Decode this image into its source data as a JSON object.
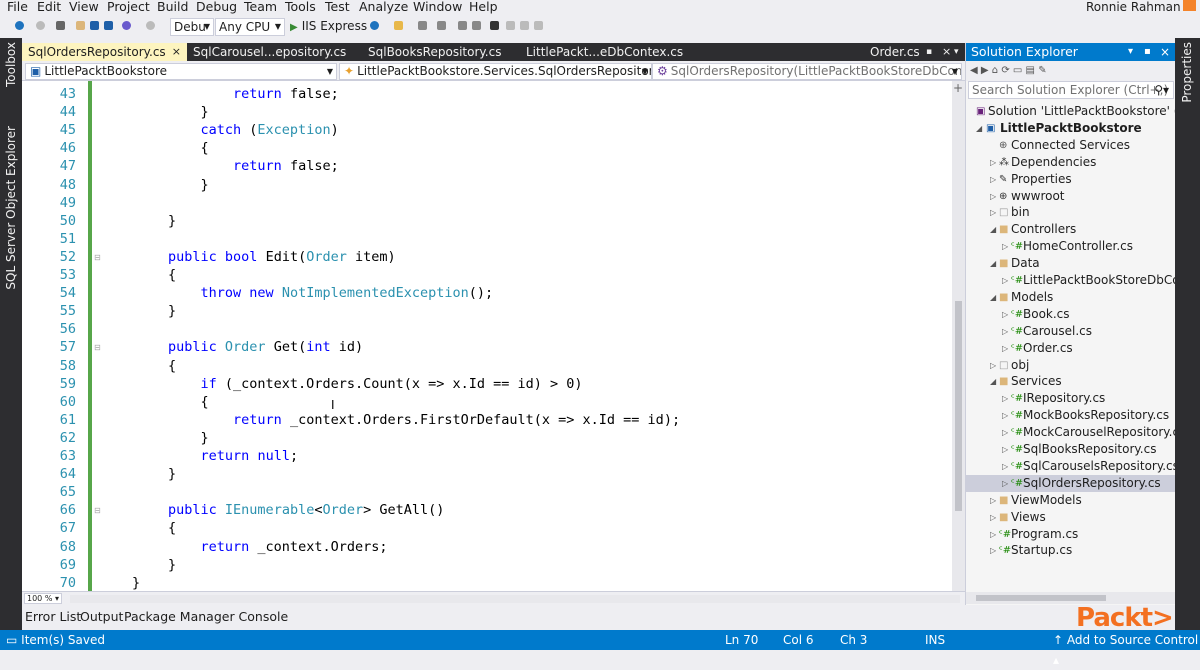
{
  "menu": [
    "File",
    "Edit",
    "View",
    "Project",
    "Build",
    "Debug",
    "Team",
    "Tools",
    "Test",
    "Analyze",
    "Window",
    "Help"
  ],
  "user": "Ronnie Rahman",
  "toolbar": {
    "config": "Debu",
    "platform": "Any CPU",
    "run": "IIS Express"
  },
  "tabs": [
    {
      "label": "SqlOrdersRepository.cs",
      "close": "×",
      "active": true
    },
    {
      "label": "SqlCarousel...epository.cs"
    },
    {
      "label": "SqlBooksRepository.cs"
    },
    {
      "label": "LittlePackt...eDbContex.cs"
    },
    {
      "label": "Order.cs"
    }
  ],
  "nav": {
    "project": "LittlePacktBookstore",
    "class": "LittlePacktBookstore.Services.SqlOrdersRepository",
    "member": "SqlOrdersRepository(LittlePacktBookStoreDbContex cor"
  },
  "left_rail": [
    "Toolbox",
    "SQL Server Object Explorer"
  ],
  "right_rail": "Properties",
  "code": {
    "line_numbers": [
      "43",
      "44",
      "45",
      "46",
      "47",
      "48",
      "49",
      "50",
      "51",
      "52",
      "53",
      "54",
      "55",
      "56",
      "57",
      "58",
      "59",
      "60",
      "61",
      "62",
      "63",
      "64",
      "65",
      "66",
      "67",
      "68",
      "69",
      "70"
    ],
    "lines": [
      [
        [
          "        ",
          ""
        ],
        [
          "return",
          "kw"
        ],
        [
          " false;",
          ""
        ]
      ],
      [
        [
          "    }",
          ""
        ]
      ],
      [
        [
          "    ",
          ""
        ],
        [
          "catch",
          "kw"
        ],
        [
          " (",
          ""
        ],
        [
          "Exception",
          "ty"
        ],
        [
          ")",
          ""
        ]
      ],
      [
        [
          "    {",
          ""
        ]
      ],
      [
        [
          "        ",
          ""
        ],
        [
          "return",
          "kw"
        ],
        [
          " false;",
          ""
        ]
      ],
      [
        [
          "    }",
          ""
        ]
      ],
      [
        [
          "",
          ""
        ]
      ],
      [
        [
          "}",
          ""
        ]
      ],
      [
        [
          "",
          ""
        ]
      ],
      [
        [
          "",
          ""
        ],
        [
          "public",
          "kw"
        ],
        [
          " ",
          ""
        ],
        [
          "bool",
          "kw"
        ],
        [
          " Edit(",
          ""
        ],
        [
          "Order",
          "ty"
        ],
        [
          " item)",
          ""
        ]
      ],
      [
        [
          "{",
          ""
        ]
      ],
      [
        [
          "    ",
          ""
        ],
        [
          "throw",
          "kw"
        ],
        [
          " ",
          ""
        ],
        [
          "new",
          "kw"
        ],
        [
          " ",
          ""
        ],
        [
          "NotImplementedException",
          "ty"
        ],
        [
          "();",
          ""
        ]
      ],
      [
        [
          "}",
          ""
        ]
      ],
      [
        [
          "",
          ""
        ]
      ],
      [
        [
          "",
          ""
        ],
        [
          "public",
          "kw"
        ],
        [
          " ",
          ""
        ],
        [
          "Order",
          "ty"
        ],
        [
          " Get(",
          ""
        ],
        [
          "int",
          "kw"
        ],
        [
          " id)",
          ""
        ]
      ],
      [
        [
          "{",
          ""
        ]
      ],
      [
        [
          "    ",
          ""
        ],
        [
          "if",
          "kw"
        ],
        [
          " (_context.Orders.Count(x => x.Id == id) > 0)",
          ""
        ]
      ],
      [
        [
          "    {",
          ""
        ]
      ],
      [
        [
          "        ",
          ""
        ],
        [
          "return",
          "kw"
        ],
        [
          " _context.Orders.FirstOrDefault(x => x.Id == id);",
          ""
        ]
      ],
      [
        [
          "    }",
          ""
        ]
      ],
      [
        [
          "    ",
          ""
        ],
        [
          "return",
          "kw"
        ],
        [
          " ",
          ""
        ],
        [
          "null",
          "kw"
        ],
        [
          ";",
          ""
        ]
      ],
      [
        [
          "}",
          ""
        ]
      ],
      [
        [
          "",
          ""
        ]
      ],
      [
        [
          "",
          ""
        ],
        [
          "public",
          "kw"
        ],
        [
          " ",
          ""
        ],
        [
          "IEnumerable",
          "ty"
        ],
        [
          "<",
          ""
        ],
        [
          "Order",
          "ty"
        ],
        [
          "> GetAll()",
          ""
        ]
      ],
      [
        [
          "{",
          ""
        ]
      ],
      [
        [
          "    ",
          ""
        ],
        [
          "return",
          "kw"
        ],
        [
          " _context.Orders;",
          ""
        ]
      ],
      [
        [
          "}",
          ""
        ]
      ],
      [
        [
          "}",
          ""
        ]
      ]
    ]
  },
  "zoom": "100 %",
  "bottom_tabs": [
    "Error List",
    "Output",
    "Package Manager Console"
  ],
  "status": {
    "message": "Item(s) Saved",
    "ln": "Ln 70",
    "col": "Col 6",
    "ch": "Ch 3",
    "mode": "INS",
    "source": "↑ Add to Source Control ▴"
  },
  "solution_explorer": {
    "title": "Solution Explorer",
    "search_placeholder": "Search Solution Explorer (Ctrl+;)",
    "items": [
      {
        "label": "Solution 'LittlePacktBookstore' (1 pr",
        "depth": 0,
        "arrow": "",
        "icon": "sln"
      },
      {
        "label": "LittlePacktBookstore",
        "depth": 1,
        "arrow": "open",
        "icon": "proj",
        "bold": true
      },
      {
        "label": "Connected Services",
        "depth": 2,
        "arrow": "",
        "icon": "conn"
      },
      {
        "label": "Dependencies",
        "depth": 2,
        "arrow": "closed",
        "icon": "dep"
      },
      {
        "label": "Properties",
        "depth": 2,
        "arrow": "closed",
        "icon": "wrench"
      },
      {
        "label": "wwwroot",
        "depth": 2,
        "arrow": "closed",
        "icon": "globe"
      },
      {
        "label": "bin",
        "depth": 2,
        "arrow": "closed",
        "icon": "ghost"
      },
      {
        "label": "Controllers",
        "depth": 2,
        "arrow": "open",
        "icon": "folder"
      },
      {
        "label": "HomeController.cs",
        "depth": 3,
        "arrow": "closed",
        "icon": "cs"
      },
      {
        "label": "Data",
        "depth": 2,
        "arrow": "open",
        "icon": "folder"
      },
      {
        "label": "LittlePacktBookStoreDbConte",
        "depth": 3,
        "arrow": "closed",
        "icon": "cs"
      },
      {
        "label": "Models",
        "depth": 2,
        "arrow": "open",
        "icon": "folder"
      },
      {
        "label": "Book.cs",
        "depth": 3,
        "arrow": "closed",
        "icon": "cs"
      },
      {
        "label": "Carousel.cs",
        "depth": 3,
        "arrow": "closed",
        "icon": "cs"
      },
      {
        "label": "Order.cs",
        "depth": 3,
        "arrow": "closed",
        "icon": "cs"
      },
      {
        "label": "obj",
        "depth": 2,
        "arrow": "closed",
        "icon": "ghost"
      },
      {
        "label": "Services",
        "depth": 2,
        "arrow": "open",
        "icon": "folder"
      },
      {
        "label": "IRepository.cs",
        "depth": 3,
        "arrow": "closed",
        "icon": "cs"
      },
      {
        "label": "MockBooksRepository.cs",
        "depth": 3,
        "arrow": "closed",
        "icon": "cs"
      },
      {
        "label": "MockCarouselRepository.cs",
        "depth": 3,
        "arrow": "closed",
        "icon": "cs"
      },
      {
        "label": "SqlBooksRepository.cs",
        "depth": 3,
        "arrow": "closed",
        "icon": "cs"
      },
      {
        "label": "SqlCarouselsRepository.cs",
        "depth": 3,
        "arrow": "closed",
        "icon": "cs"
      },
      {
        "label": "SqlOrdersRepository.cs",
        "depth": 3,
        "arrow": "closed",
        "icon": "cs",
        "selected": true
      },
      {
        "label": "ViewModels",
        "depth": 2,
        "arrow": "closed",
        "icon": "folder"
      },
      {
        "label": "Views",
        "depth": 2,
        "arrow": "closed",
        "icon": "folder"
      },
      {
        "label": "Program.cs",
        "depth": 2,
        "arrow": "closed",
        "icon": "cs"
      },
      {
        "label": "Startup.cs",
        "depth": 2,
        "arrow": "closed",
        "icon": "cs"
      }
    ]
  },
  "watermark": "Packt>",
  "colors": {
    "accent": "#007acc",
    "keyword": "#0000ff",
    "type": "#2b91af",
    "change_bar": "#57a64a",
    "active_tab": "#fdf4bf",
    "brand": "#f37021"
  }
}
